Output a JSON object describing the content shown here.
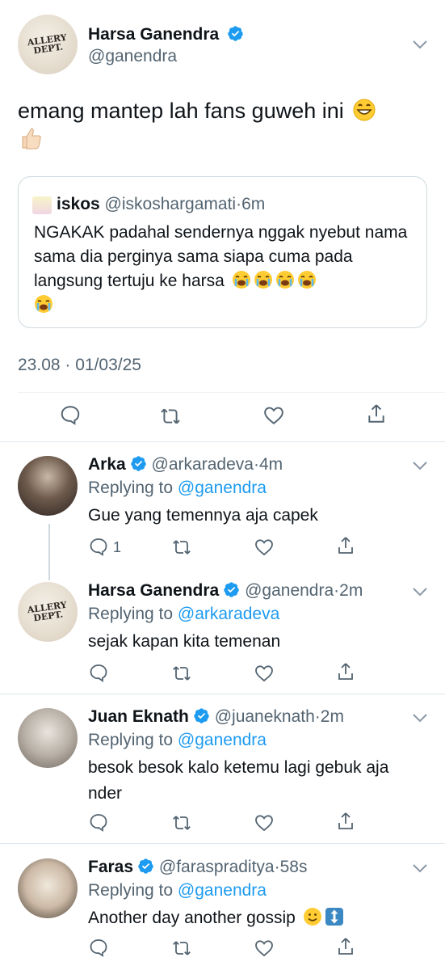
{
  "main_tweet": {
    "author_name": "Harsa Ganendra",
    "author_handle": "@ganendra",
    "avatar_text": "GALLERY DEPT.",
    "text": "emang mantep lah fans guweh ini",
    "quote": {
      "author_name": "iskos",
      "author_handle": "@iskoshargamati",
      "separator": "·",
      "time": "6m",
      "text": "NGAKAK padahal sendernya nggak nyebut nama sama dia perginya sama siapa cuma pada langsung tertuju ke harsa"
    },
    "timestamp": "23.08 · 01/03/25"
  },
  "replies": [
    {
      "author_name": "Arka",
      "author_handle": "@arkaradeva",
      "separator": "·",
      "time": "4m",
      "replying_label": "Replying to",
      "replying_to": "@ganendra",
      "text": "Gue yang temennya aja capek",
      "reply_count": "1"
    },
    {
      "author_name": "Harsa Ganendra",
      "author_handle": "@ganendra",
      "separator": "·",
      "time": "2m",
      "replying_label": "Replying to",
      "replying_to": "@arkaradeva",
      "text": "sejak kapan kita temenan",
      "avatar_text": "GALLERY DEPT."
    },
    {
      "author_name": "Juan Eknath",
      "author_handle": "@juaneknath",
      "separator": "·",
      "time": "2m",
      "replying_label": "Replying to",
      "replying_to": "@ganendra",
      "text": "besok besok kalo ketemu lagi gebuk aja nder"
    },
    {
      "author_name": "Faras",
      "author_handle": "@faraspraditya",
      "separator": "·",
      "time": "58s",
      "replying_label": "Replying to",
      "replying_to": "@ganendra",
      "text": "Another day another gossip"
    }
  ],
  "icons": {
    "verified": "verified-badge-icon",
    "reply": "reply-icon",
    "retweet": "retweet-icon",
    "like": "heart-icon",
    "share": "share-icon",
    "more": "chevron-down-icon"
  },
  "colors": {
    "accent": "#1d9bf0",
    "secondary_text": "#536471",
    "border": "#cfd9de"
  }
}
